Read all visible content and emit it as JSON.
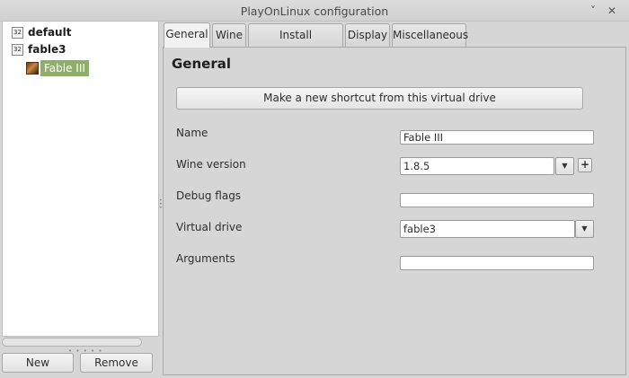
{
  "window": {
    "title": "PlayOnLinux configuration",
    "minimize": "˅",
    "close": "✕"
  },
  "tree": {
    "items": [
      {
        "label": "default",
        "icon": "32"
      },
      {
        "label": "fable3",
        "icon": "32"
      }
    ],
    "child": {
      "label": "Fable III"
    },
    "grip": "• • • • •"
  },
  "buttons": {
    "new": "New",
    "remove": "Remove"
  },
  "tabs": [
    {
      "label": "General"
    },
    {
      "label": "Wine"
    },
    {
      "label": "Install components"
    },
    {
      "label": "Display"
    },
    {
      "label": "Miscellaneous"
    }
  ],
  "general": {
    "heading": "General",
    "shortcut_button": "Make a new shortcut from this virtual drive",
    "fields": {
      "name": {
        "label": "Name",
        "value": "Fable III"
      },
      "wine_version": {
        "label": "Wine version",
        "value": "1.8.5"
      },
      "debug_flags": {
        "label": "Debug flags",
        "value": ""
      },
      "virtual_drive": {
        "label": "Virtual drive",
        "value": "fable3"
      },
      "arguments": {
        "label": "Arguments",
        "value": ""
      }
    },
    "arrow_glyph": "▼",
    "plus_glyph": "+"
  },
  "colors": {
    "selection": "#8fad6b",
    "window_bg": "#d6d6d6",
    "titlebar": "#d4d4d4"
  }
}
